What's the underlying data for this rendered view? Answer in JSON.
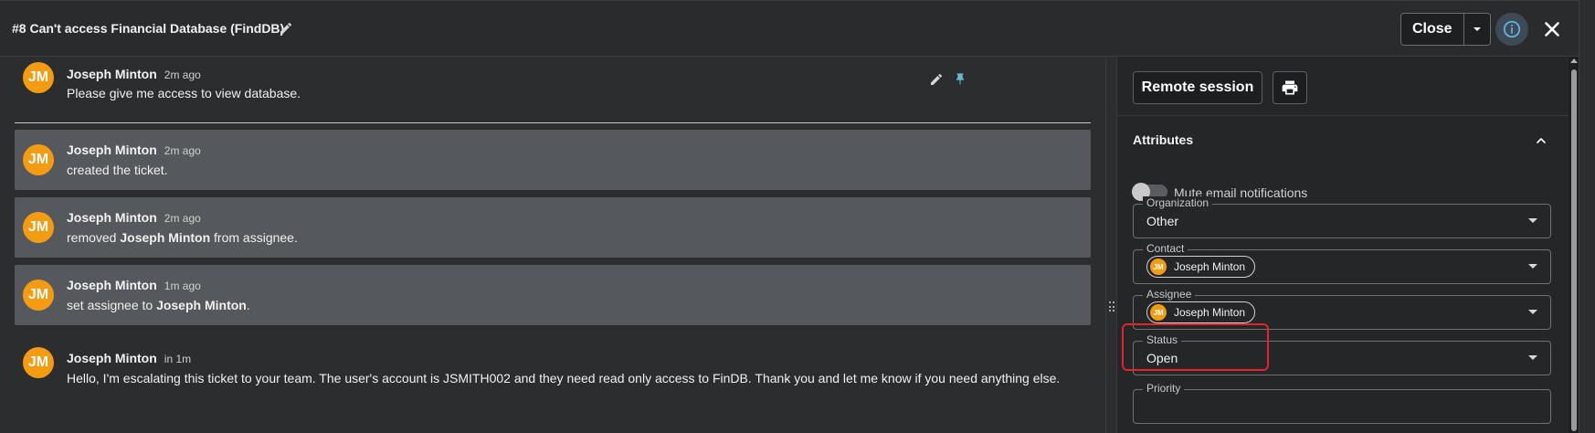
{
  "header": {
    "title": "#8 Can't access Financial Database (FindDB)",
    "close_label": "Close"
  },
  "conversation": {
    "top_message": {
      "initials": "JM",
      "author": "Joseph Minton",
      "time": "2m ago",
      "text": "Please give me access to view database."
    },
    "events": [
      {
        "initials": "JM",
        "author": "Joseph Minton",
        "time": "2m ago",
        "pre": "created the ticket.",
        "bold": "",
        "post": ""
      },
      {
        "initials": "JM",
        "author": "Joseph Minton",
        "time": "2m ago",
        "pre": "removed ",
        "bold": "Joseph Minton",
        "post": " from assignee."
      },
      {
        "initials": "JM",
        "author": "Joseph Minton",
        "time": "1m ago",
        "pre": "set assignee to ",
        "bold": "Joseph Minton",
        "post": "."
      }
    ],
    "last_message": {
      "initials": "JM",
      "author": "Joseph Minton",
      "time": "in 1m",
      "text": "Hello, I'm escalating this ticket to your team. The user's account is JSMITH002 and they need read only access to FinDB. Thank you and let me know if you need anything else."
    }
  },
  "sidebar": {
    "remote_session_label": "Remote session",
    "attributes_title": "Attributes",
    "mute_label": "Mute email notifications",
    "mute_enabled": false,
    "fields": {
      "organization": {
        "label": "Organization",
        "value": "Other"
      },
      "contact": {
        "label": "Contact",
        "initials": "JM",
        "value": "Joseph Minton"
      },
      "assignee": {
        "label": "Assignee",
        "initials": "JM",
        "value": "Joseph Minton"
      },
      "status": {
        "label": "Status",
        "value": "Open"
      },
      "priority": {
        "label": "Priority"
      }
    }
  },
  "colors": {
    "avatar": "#f39c12",
    "highlight": "#e0252c",
    "info_icon": "#5fb3e0"
  }
}
